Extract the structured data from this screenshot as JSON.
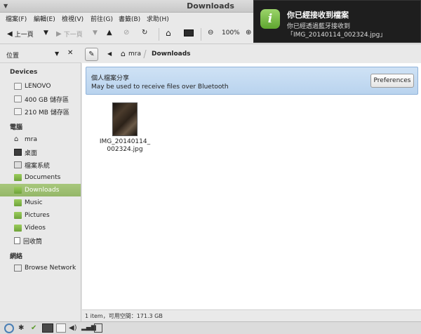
{
  "window": {
    "title": "Downloads"
  },
  "menubar": {
    "items": [
      "檔案(F)",
      "編輯(E)",
      "檢視(V)",
      "前往(G)",
      "書籤(B)",
      "求助(H)"
    ]
  },
  "toolbar": {
    "back_label": "上一頁",
    "forward_label": "下一頁",
    "zoom_label": "100%"
  },
  "sidebar": {
    "header_label": "位置",
    "sections": {
      "devices": "Devices",
      "computer": "電腦",
      "network": "網絡"
    },
    "devices": [
      "LENOVO",
      "400 GB 儲存區",
      "210 MB 儲存區"
    ],
    "computer": [
      "mra",
      "桌面",
      "檔案系統",
      "Documents",
      "Downloads",
      "Music",
      "Pictures",
      "Videos",
      "回收筒"
    ],
    "network": [
      "Browse Network"
    ],
    "selected": "Downloads"
  },
  "location": {
    "home": "mra",
    "current": "Downloads"
  },
  "banner": {
    "title": "個人檔案分享",
    "text": "May be used to receive files over Bluetooth",
    "button_label": "Preferences",
    "color": "#b9d3ee"
  },
  "files": [
    {
      "name_line1": "IMG_20140114_",
      "name_line2": "002324.jpg"
    }
  ],
  "statusbar": {
    "text": "1 item，可用空間：171.3 GB"
  },
  "notification": {
    "title": "你已經接收到檔案",
    "line1": "你已經透過藍牙接收到",
    "line2": "「IMG_20140114_002324.jpg」",
    "icon": "info-icon"
  },
  "colors": {
    "selected_item": "#94b768",
    "notification_bg": "#1e1e1e"
  }
}
